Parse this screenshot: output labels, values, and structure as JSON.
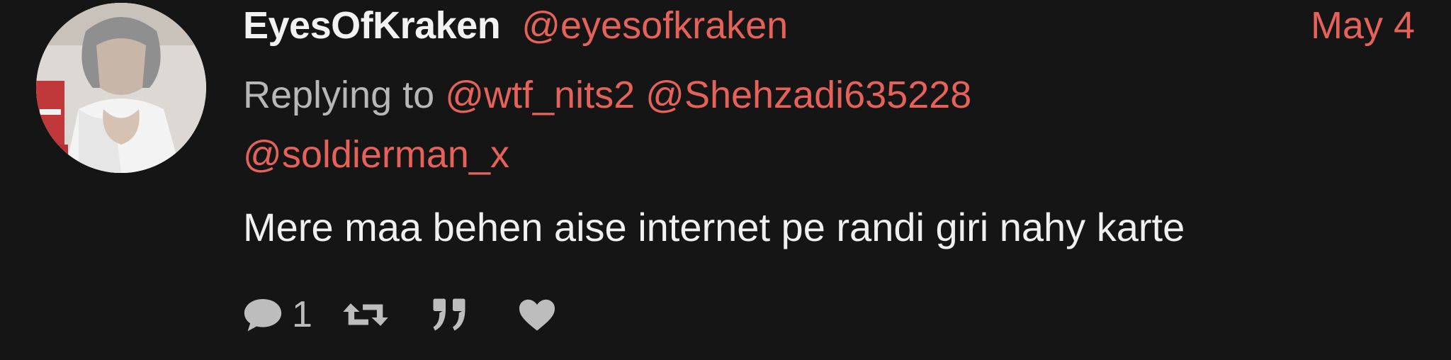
{
  "tweet": {
    "display_name": "EyesOfKraken",
    "handle": "@eyesofkraken",
    "date": "May 4",
    "replying_prefix": "Replying to",
    "reply_mentions": [
      "@wtf_nits2",
      "@Shehzadi635228",
      "@soldierman_x"
    ],
    "text": "Mere maa behen aise internet pe randi giri nahy karte",
    "reply_count": "1"
  },
  "icons": {
    "reply": "speech-bubble-icon",
    "retweet": "retweet-icon",
    "quote": "quote-icon",
    "like": "heart-icon"
  },
  "colors": {
    "background": "#151515",
    "accent": "#e5625a",
    "text": "#f0f0f0",
    "muted": "#bdbdbd"
  }
}
